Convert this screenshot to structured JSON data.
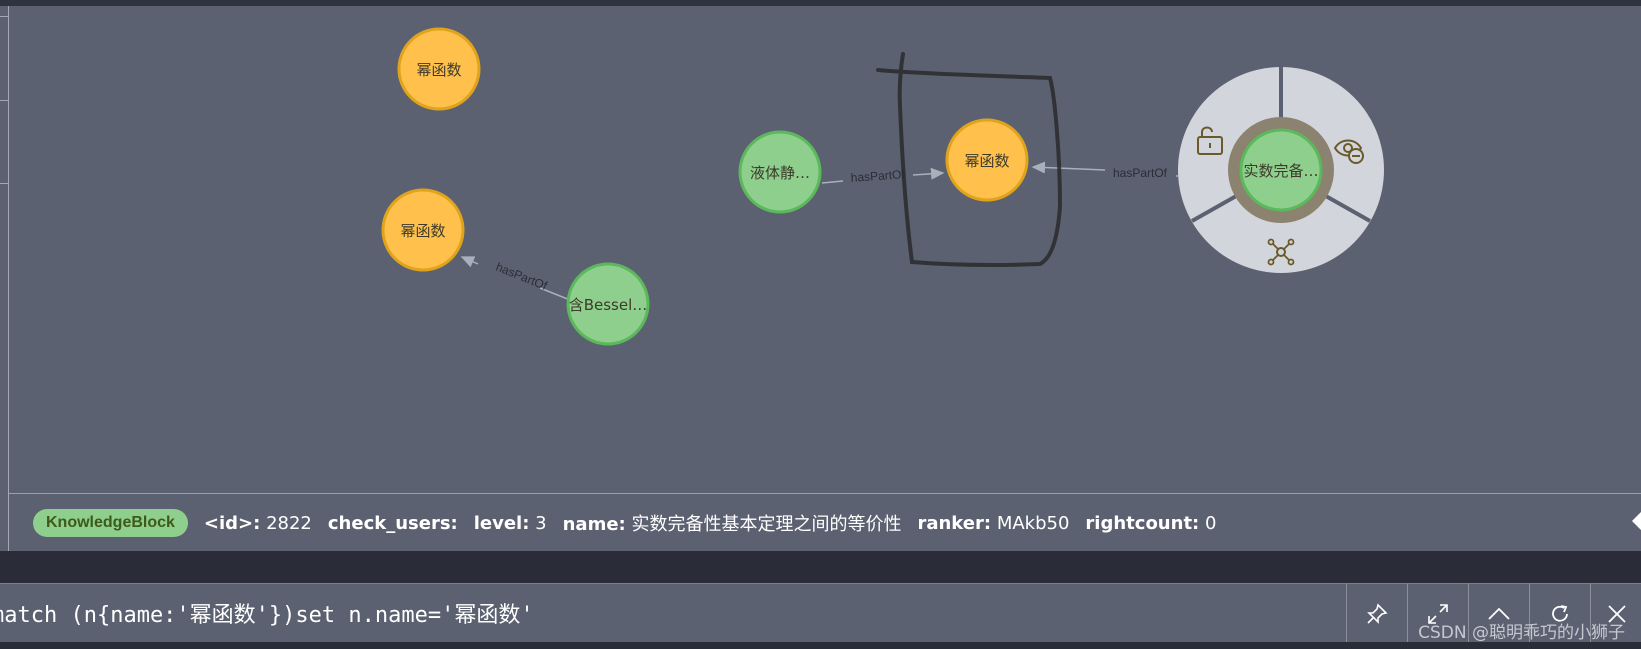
{
  "graph": {
    "nodes": [
      {
        "id": "n1",
        "label": "幂函数",
        "type": "orange"
      },
      {
        "id": "n2",
        "label": "幂函数",
        "type": "orange"
      },
      {
        "id": "n3",
        "label": "含Bessel…",
        "type": "green"
      },
      {
        "id": "n4",
        "label": "液体静…",
        "type": "green"
      },
      {
        "id": "n5",
        "label": "幂函数",
        "type": "orange"
      },
      {
        "id": "n6",
        "label": "实数完备…",
        "type": "green",
        "selected": true
      }
    ],
    "relationships": [
      {
        "from": "n3",
        "to": "n2",
        "label": "hasPartOf"
      },
      {
        "from": "n4",
        "to": "n5",
        "label": "hasPartOf"
      },
      {
        "from": "n6",
        "to": "n5",
        "label": "hasPartOf"
      }
    ],
    "ring_menu": {
      "items": [
        "unlock-icon",
        "hide-icon",
        "expand-icon"
      ]
    },
    "colors": {
      "orange_fill": "#ffc04c",
      "orange_stroke": "#e0a41c",
      "green_fill": "#8ecf8e",
      "green_stroke": "#5bb85b",
      "background": "#5b6170"
    }
  },
  "properties": {
    "label_badge": "KnowledgeBlock",
    "items": [
      {
        "key": "<id>:",
        "value": "2822"
      },
      {
        "key": "check_users:",
        "value": ""
      },
      {
        "key": "level:",
        "value": "3"
      },
      {
        "key": "name:",
        "value": "实数完备性基本定理之间的等价性"
      },
      {
        "key": "ranker:",
        "value": "MAkb50"
      },
      {
        "key": "rightcount:",
        "value": "0"
      }
    ]
  },
  "editor": {
    "query": "match (n{name:'幂函数'})set n.name='幂函数'",
    "tools": [
      "pin-icon",
      "fullscreen-icon",
      "collapse-up-icon",
      "rerun-icon",
      "close-icon"
    ]
  },
  "watermark": "CSDN @聪明乖巧的小狮子"
}
